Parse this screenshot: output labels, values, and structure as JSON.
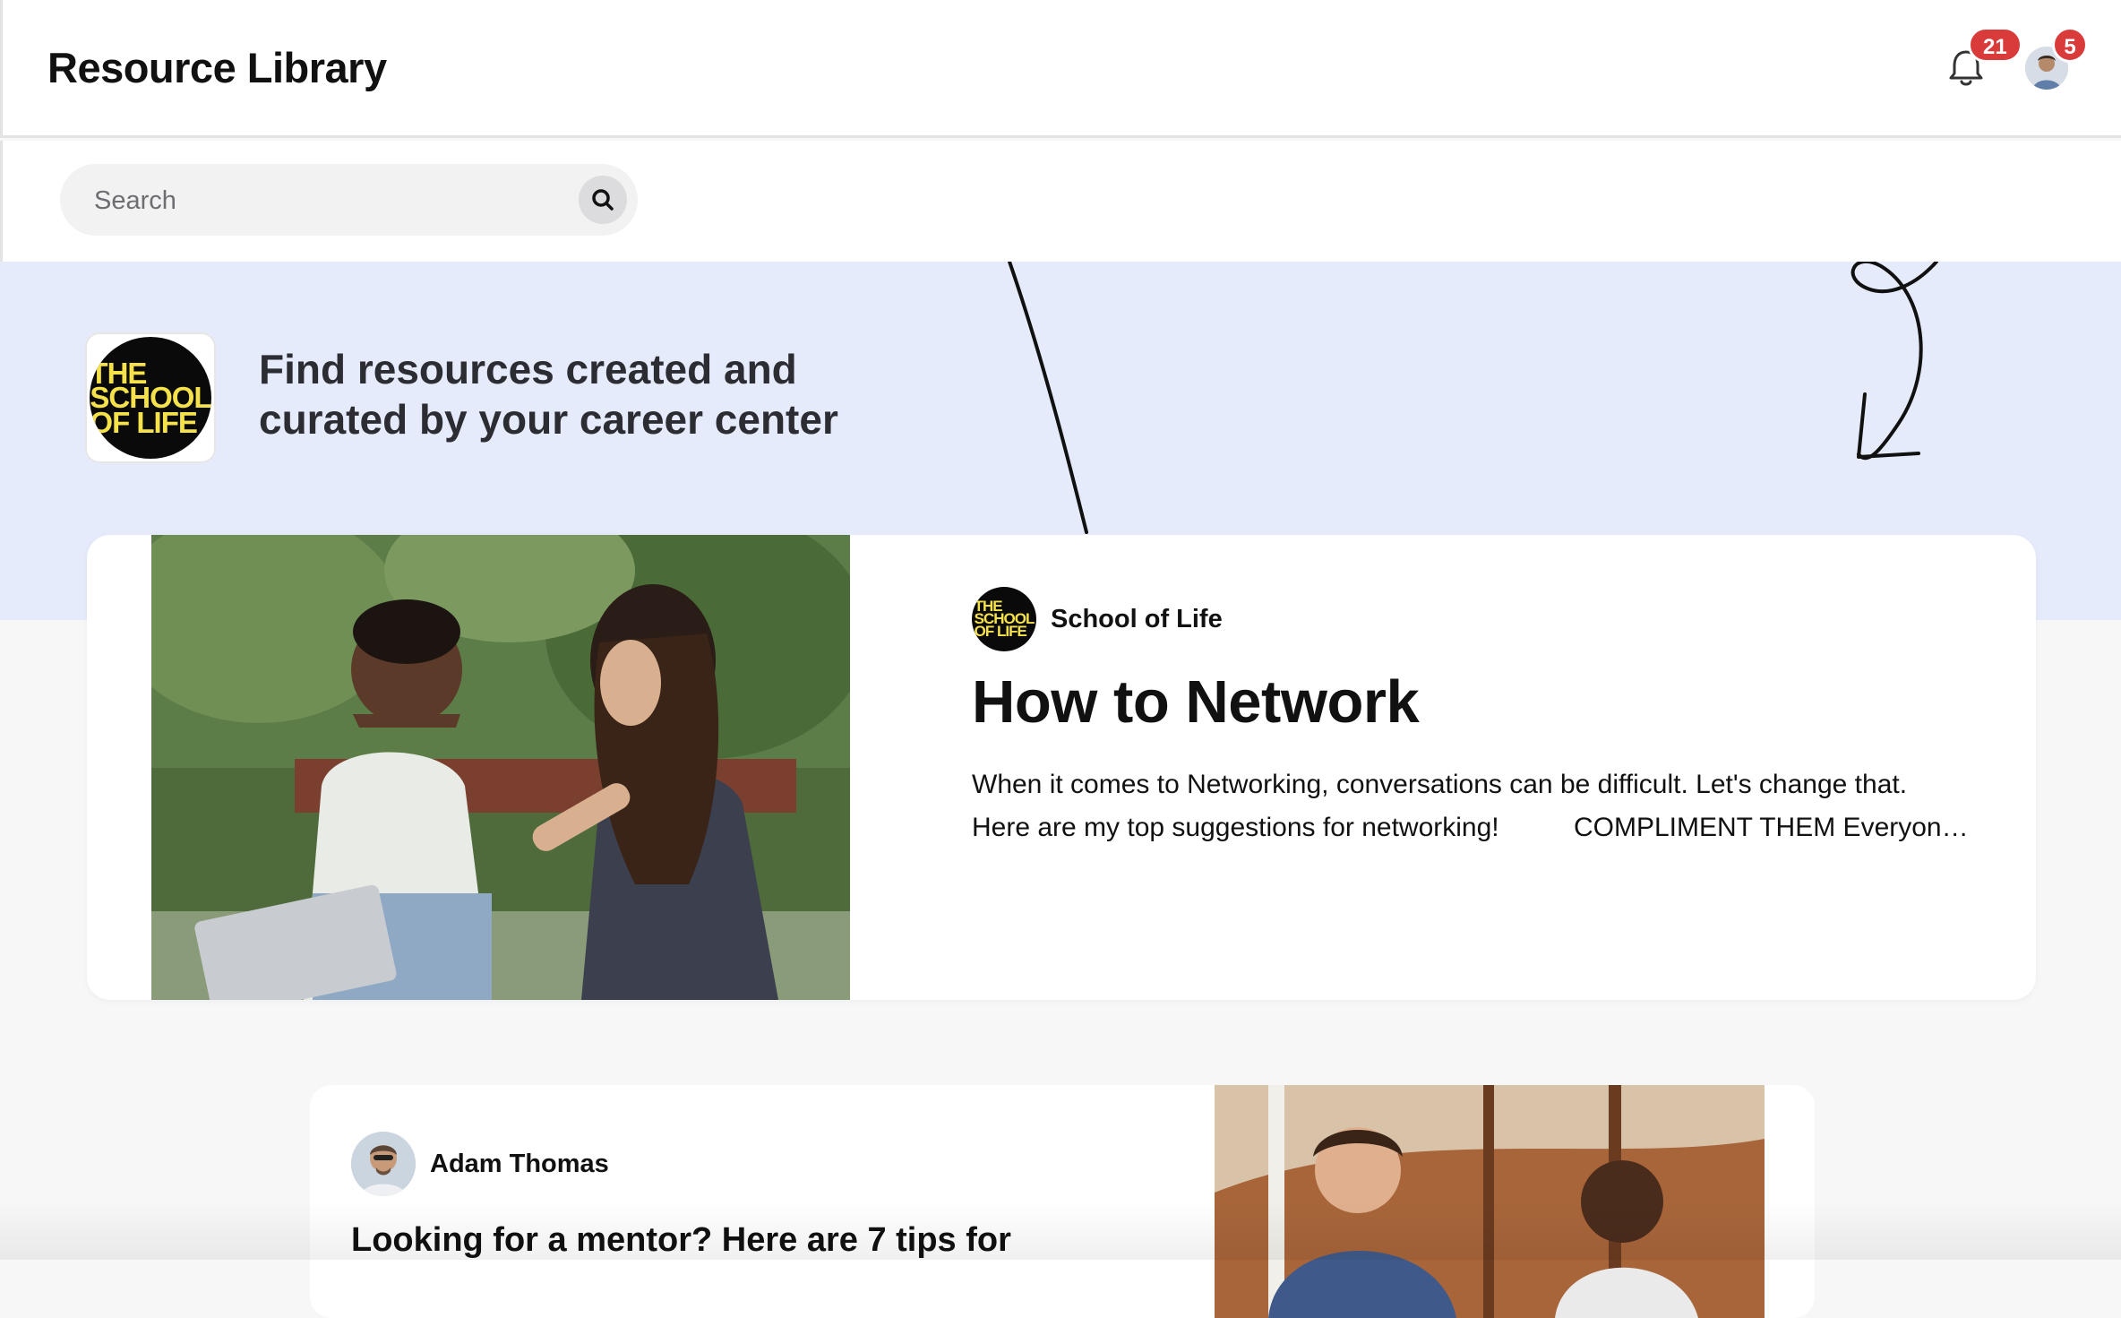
{
  "header": {
    "title": "Resource Library",
    "notification_count": "21",
    "user_badge_count": "5",
    "icons": {
      "notifications": "bell-icon",
      "user": "user-avatar"
    }
  },
  "search": {
    "placeholder": "Search",
    "icon": "search-icon"
  },
  "hero": {
    "logo_text": "THE\nSCHOOL\nOF LIFE",
    "line1": "Find resources created and",
    "line2": "curated by your career center",
    "background_color": "#e6ebfb"
  },
  "featured": {
    "author": "School of Life",
    "author_logo_text": "THE\nSCHOOL\nOF LIFE",
    "title": "How to Network",
    "description_line1": "When it comes to Networking, conversations can be difficult. Let's change that.",
    "description_line2": "Here are my top suggestions for networking!          COMPLIMENT THEM Everyone likes a compliment"
  },
  "second_card": {
    "author": "Adam Thomas",
    "title": "Looking for a mentor? Here are 7 tips for"
  },
  "colors": {
    "badge": "#d93a3a",
    "logo_yellow": "#f5e14a",
    "hero_bg": "#e6ebfb"
  }
}
